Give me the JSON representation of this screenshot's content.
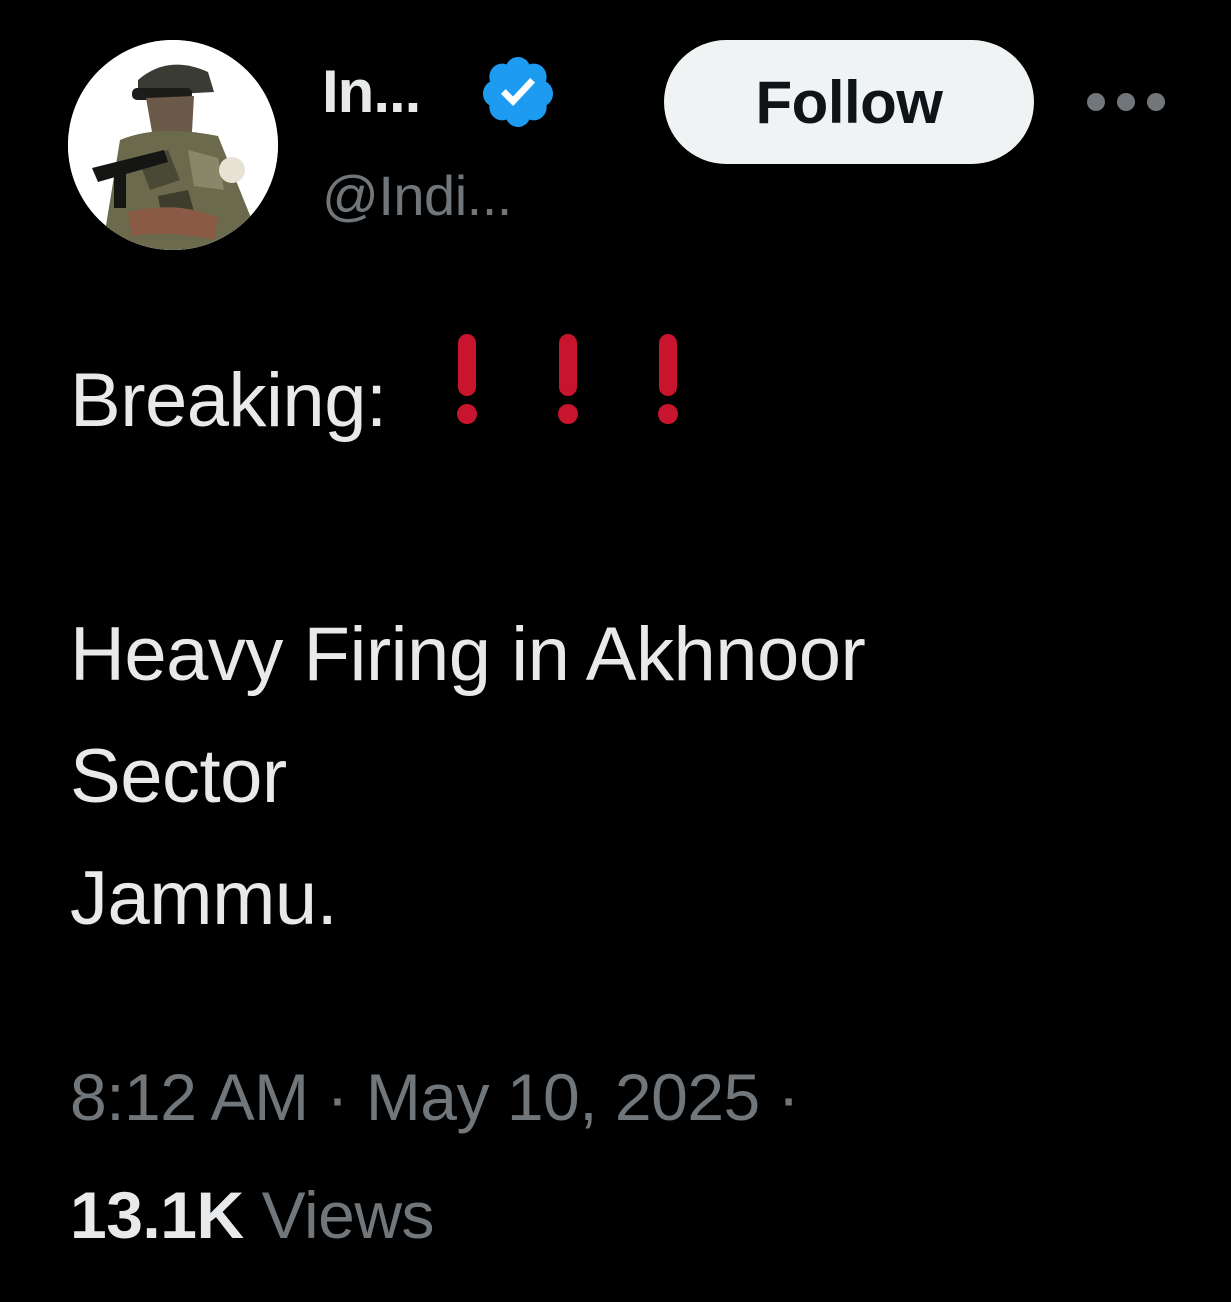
{
  "author": {
    "display_name": "In...",
    "handle": "@Indi...",
    "verified": true,
    "verified_color": "#1d9bf0",
    "avatar_icon": "soldier-avatar"
  },
  "actions": {
    "follow_label": "Follow",
    "more_icon": "more-horizontal-icon"
  },
  "tweet": {
    "lines": [
      "Breaking:",
      "Heavy Firing in Akhnoor",
      "Sector",
      "Jammu."
    ],
    "exclamation_icon": "red-exclamation-icon",
    "exclamation_color": "#c8142c",
    "exclamation_count": 3
  },
  "meta": {
    "time": "8:12 AM",
    "separator": "·",
    "date": "May 10, 2025",
    "views_count": "13.1K",
    "views_label": "Views"
  },
  "colors": {
    "background": "#000000",
    "text": "#e7e9ea",
    "secondary": "#71767b",
    "follow_bg": "#eff3f4"
  }
}
